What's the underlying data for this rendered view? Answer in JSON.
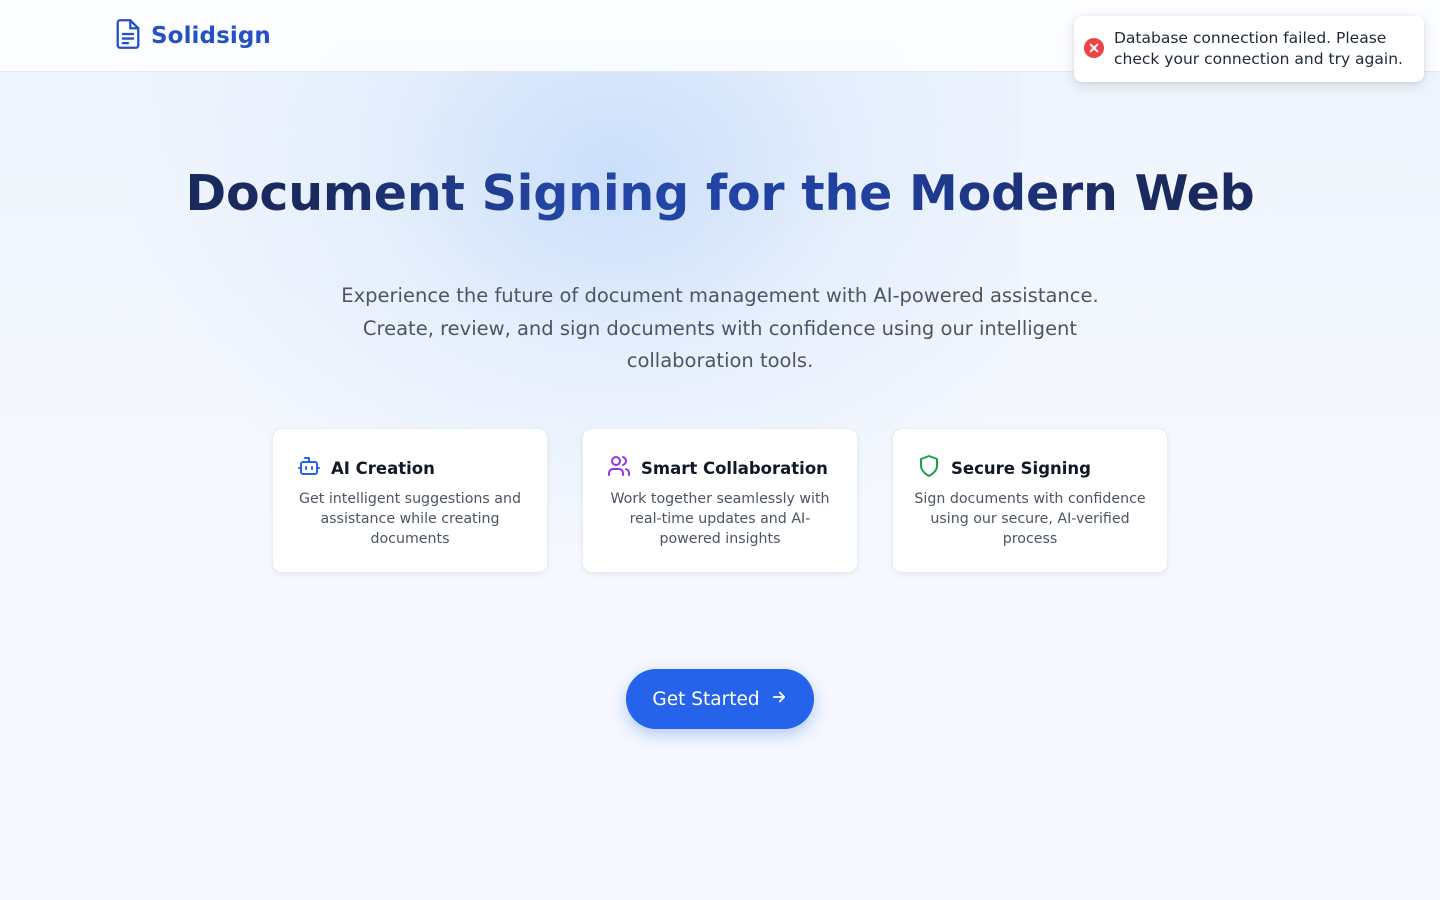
{
  "app": {
    "name": "Solidsign",
    "logo_icon": "document-icon"
  },
  "toast": {
    "type": "error",
    "icon": "error-circle-icon",
    "message": "Database connection failed. Please check your connection and try again."
  },
  "hero": {
    "title": "Document Signing for the Modern Web",
    "subtitle": "Experience the future of document management with AI-powered assistance. Create, review, and sign documents with confidence using our intelligent collaboration tools."
  },
  "features": [
    {
      "icon": "robot-icon",
      "title": "AI Creation",
      "description": "Get intelligent suggestions and assistance while creating documents",
      "color": "#2563eb"
    },
    {
      "icon": "users-icon",
      "title": "Smart Collaboration",
      "description": "Work together seamlessly with real-time updates and AI-powered insights",
      "color": "#9333ea"
    },
    {
      "icon": "shield-icon",
      "title": "Secure Signing",
      "description": "Sign documents with confidence using our secure, AI-verified process",
      "color": "#16a34a"
    }
  ],
  "cta": {
    "label": "Get Started",
    "icon": "arrow-right-icon"
  },
  "colors": {
    "brand": "#2452c6",
    "primary": "#2563eb",
    "error": "#ef4444"
  }
}
